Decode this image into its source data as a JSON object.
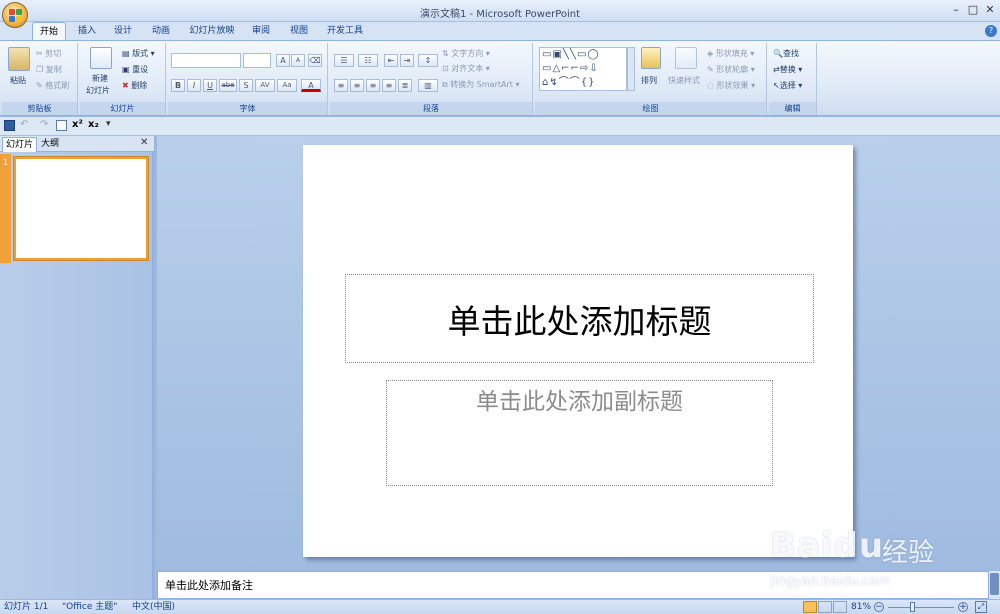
{
  "window": {
    "title": "演示文稿1 - Microsoft PowerPoint",
    "minimize": "–",
    "maximize": "□",
    "close": "✕"
  },
  "tabs": [
    "开始",
    "插入",
    "设计",
    "动画",
    "幻灯片放映",
    "审阅",
    "视图",
    "开发工具"
  ],
  "ribbon": {
    "clipboard": {
      "paste": "粘贴",
      "cut": "剪切",
      "copy": "复制",
      "format_painter": "格式刷",
      "label": "剪贴板"
    },
    "slides": {
      "new_slide_1": "新建",
      "new_slide_2": "幻灯片",
      "layout": "版式",
      "reset": "重设",
      "delete": "删除",
      "label": "幻灯片"
    },
    "font": {
      "label": "字体",
      "bold": "B",
      "italic": "I",
      "underline": "U",
      "strike": "abe",
      "shadow": "S",
      "spacing": "AV",
      "case": "Aa",
      "color": "A",
      "grow": "A",
      "shrink": "A"
    },
    "paragraph": {
      "text_direction": "文字方向",
      "align_text": "对齐文本",
      "smartart": "转换为 SmartArt",
      "label": "段落"
    },
    "drawing": {
      "arrange": "排列",
      "quick_styles": "快速样式",
      "shape_fill": "形状填充",
      "shape_outline": "形状轮廓",
      "shape_effects": "形状效果",
      "label": "绘图"
    },
    "editing": {
      "find": "查找",
      "replace": "替换",
      "select": "选择",
      "label": "编辑"
    }
  },
  "panel": {
    "tab_slides": "幻灯片",
    "tab_outline": "大纲",
    "close": "✕",
    "slide_number": "1"
  },
  "slide": {
    "title_placeholder": "单击此处添加标题",
    "subtitle_placeholder": "单击此处添加副标题"
  },
  "notes": {
    "placeholder": "单击此处添加备注"
  },
  "status": {
    "slide": "幻灯片 1/1",
    "theme": "\"Office 主题\"",
    "language": "中文(中国)",
    "zoom": "81%"
  },
  "watermark": {
    "brand": "Baidu",
    "brand_cn": "经验",
    "url": "jingyan.baidu.com"
  }
}
